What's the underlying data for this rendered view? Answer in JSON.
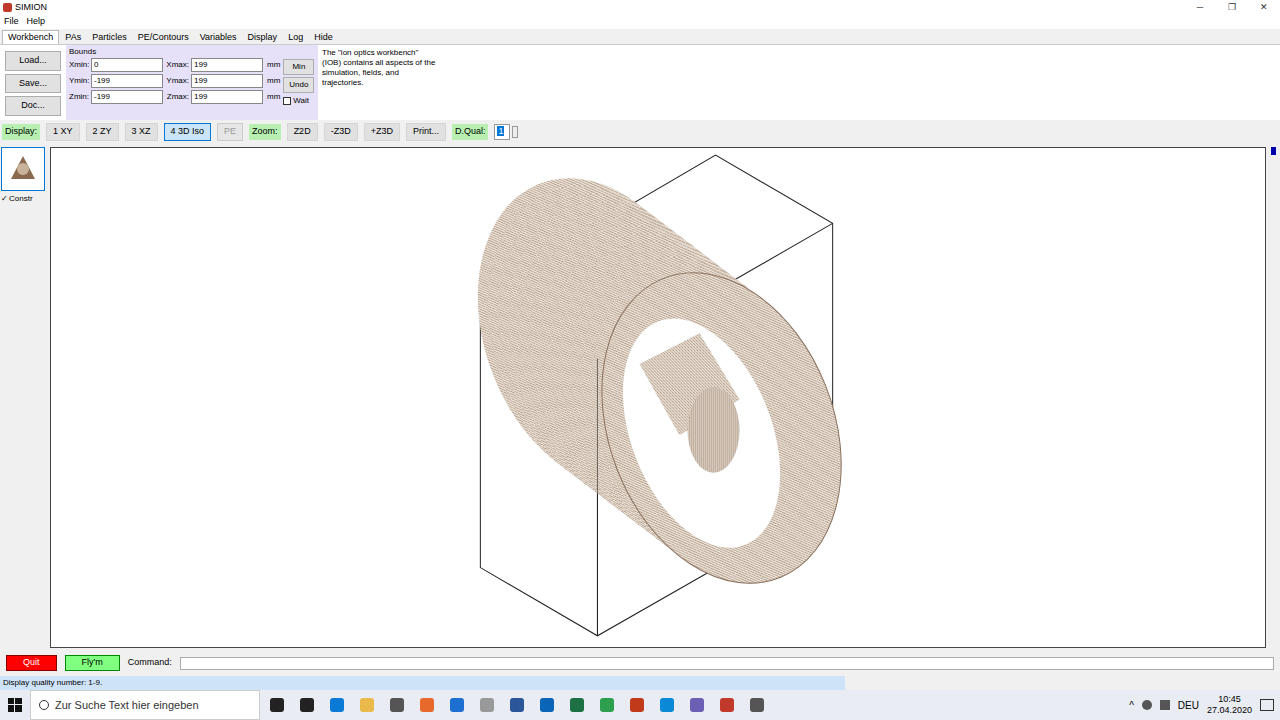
{
  "window": {
    "title": "SIMION",
    "controls": [
      "─",
      "❐",
      "✕"
    ]
  },
  "menu": [
    "File",
    "Help"
  ],
  "tabs": [
    {
      "label": "Workbench",
      "selected": true
    },
    {
      "label": "PAs",
      "selected": false
    },
    {
      "label": "Particles",
      "selected": false
    },
    {
      "label": "PE/Contours",
      "selected": false
    },
    {
      "label": "Variables",
      "selected": false
    },
    {
      "label": "Display",
      "selected": false
    },
    {
      "label": "Log",
      "selected": false
    },
    {
      "label": "Hide",
      "selected": false
    }
  ],
  "file_buttons": [
    "Load...",
    "Save...",
    "Doc..."
  ],
  "bounds": {
    "title": "Bounds",
    "rows": [
      {
        "min_label": "Xmin:",
        "min_value": "0",
        "max_label": "Xmax:",
        "max_value": "199",
        "unit": "mm"
      },
      {
        "min_label": "Ymin:",
        "min_value": "-199",
        "max_label": "Ymax:",
        "max_value": "199",
        "unit": "mm"
      },
      {
        "min_label": "Zmin:",
        "min_value": "-199",
        "max_label": "Zmax:",
        "max_value": "199",
        "unit": "mm"
      }
    ],
    "buttons": [
      "Min",
      "Undo"
    ],
    "wait": {
      "label": "Wait",
      "checked": false
    }
  },
  "description": [
    "The \"ion optics workbench\"",
    "(IOB) contains all aspects of the",
    "simulation, fields, and",
    "trajectories."
  ],
  "display_bar": [
    {
      "kind": "label",
      "text": "Display:"
    },
    {
      "kind": "button",
      "text": "1 XY",
      "selected": false,
      "disabled": false
    },
    {
      "kind": "button",
      "text": "2 ZY",
      "selected": false,
      "disabled": false
    },
    {
      "kind": "button",
      "text": "3 XZ",
      "selected": false,
      "disabled": false
    },
    {
      "kind": "button",
      "text": "4 3D Iso",
      "selected": true,
      "disabled": false
    },
    {
      "kind": "button",
      "text": "PE",
      "selected": false,
      "disabled": true
    },
    {
      "kind": "label",
      "text": "Zoom:"
    },
    {
      "kind": "button",
      "text": "Z2D",
      "selected": false,
      "disabled": false
    },
    {
      "kind": "button",
      "text": "-Z3D",
      "selected": false,
      "disabled": false
    },
    {
      "kind": "button",
      "text": "+Z3D",
      "selected": false,
      "disabled": false
    },
    {
      "kind": "button",
      "text": "Print...",
      "selected": false,
      "disabled": false
    },
    {
      "kind": "label",
      "text": "D.Qual:"
    },
    {
      "kind": "input",
      "text": "1",
      "selected": true
    }
  ],
  "instances": [
    {
      "label": "Constr",
      "checked": true
    }
  ],
  "command_bar": {
    "quit": "Quit",
    "fly": "Fly'm",
    "command_label": "Command:",
    "command_value": ""
  },
  "status_bar": "Display quality number: 1-9.",
  "taskbar": {
    "search_placeholder": "Zur Suche Text hier eingeben",
    "tray_arrow": "^",
    "language": "DEU",
    "time": "10:45",
    "date": "27.04.2020"
  }
}
